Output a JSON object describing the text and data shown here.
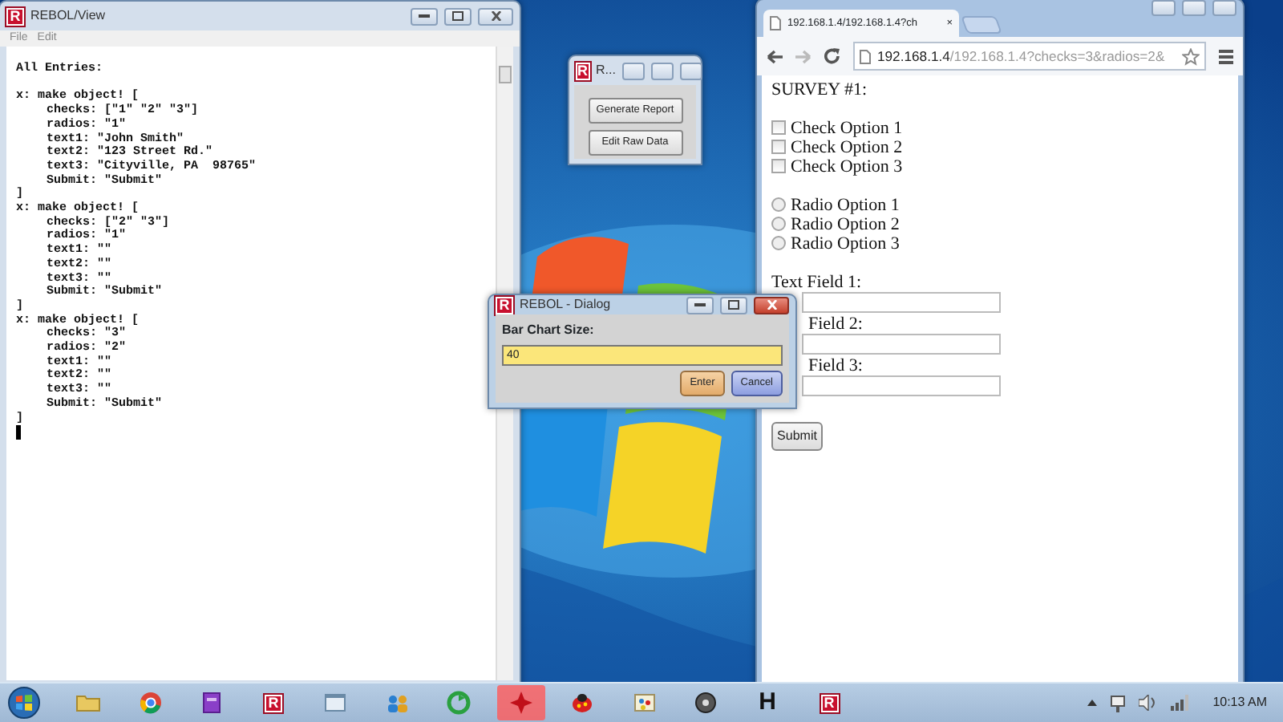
{
  "console_window": {
    "title": "REBOL/View",
    "icon_text": "R",
    "menu": [
      "File",
      "Edit"
    ],
    "heading": "All Entries:",
    "entries": [
      {
        "open": "x: make object! [",
        "fields": [
          "checks: [\"1\" \"2\" \"3\"]",
          "radios: \"1\"",
          "text1: \"John Smith\"",
          "text2: \"123 Street Rd.\"",
          "text3: \"Cityville, PA  98765\"",
          "Submit: \"Submit\""
        ],
        "close": "]"
      },
      {
        "open": "x: make object! [",
        "fields": [
          "checks: [\"2\" \"3\"]",
          "radios: \"1\"",
          "text1: \"\"",
          "text2: \"\"",
          "text3: \"\"",
          "Submit: \"Submit\""
        ],
        "close": "]"
      },
      {
        "open": "x: make object! [",
        "fields": [
          "checks: \"3\"",
          "radios: \"2\"",
          "text1: \"\"",
          "text2: \"\"",
          "text3: \"\"",
          "Submit: \"Submit\""
        ],
        "close": "]"
      }
    ]
  },
  "menu_window": {
    "title": "R...",
    "icon_text": "R",
    "buttons": [
      "Generate Report",
      "Edit Raw Data"
    ]
  },
  "browser": {
    "tab_title": "192.168.1.4/192.168.1.4?ch",
    "tab_close": "×",
    "url_host": "192.168.1.4",
    "url_rest": "/192.168.1.4?checks=3&radios=2&",
    "heading": "SURVEY #1:",
    "checkboxes": [
      {
        "label": "Check Option 1",
        "checked": false
      },
      {
        "label": "Check Option 2",
        "checked": false
      },
      {
        "label": "Check Option 3",
        "checked": false
      }
    ],
    "radios": [
      {
        "label": "Radio Option 1",
        "selected": false
      },
      {
        "label": "Radio Option 2",
        "selected": false
      },
      {
        "label": "Radio Option 3",
        "selected": false
      }
    ],
    "text_fields": [
      {
        "label": "Text Field 1:"
      },
      {
        "label": "Field 2:"
      },
      {
        "label": "Field 3:"
      }
    ],
    "submit": "Submit"
  },
  "dialog": {
    "title": "REBOL - Dialog",
    "icon_text": "R",
    "label": "Bar Chart Size:",
    "value": "40",
    "buttons": [
      {
        "label": "Enter",
        "kind": "default"
      },
      {
        "label": "Cancel",
        "kind": "cancel"
      }
    ]
  },
  "taskbar": {
    "items": [
      {
        "kind": "folder"
      },
      {
        "kind": "browser"
      },
      {
        "kind": "purple"
      },
      {
        "kind": "rebol",
        "label": "R"
      },
      {
        "kind": "window"
      },
      {
        "kind": "people"
      },
      {
        "kind": "green"
      },
      {
        "kind": "red"
      },
      {
        "kind": "bug"
      },
      {
        "kind": "paint"
      },
      {
        "kind": "disc"
      },
      {
        "kind": "letter",
        "label": "H"
      },
      {
        "kind": "rebol",
        "label": "R"
      }
    ],
    "clock": "10:13 AM"
  }
}
